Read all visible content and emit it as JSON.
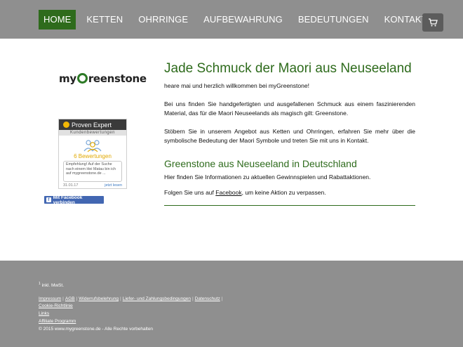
{
  "nav": {
    "items": [
      "HOME",
      "KETTEN",
      "OHRRINGE",
      "AUFBEWAHRUNG",
      "BEDEUTUNGEN",
      "KONTAKT"
    ],
    "active_index": 0,
    "active_color": "#2e6b1c",
    "cart_icon": "shopping-cart-icon"
  },
  "logo": {
    "prefix": "my",
    "suffix": "reenstone",
    "brand_color": "#2d7a26"
  },
  "proven_expert": {
    "title": "Proven Expert",
    "subtitle": "Kundenbewertungen",
    "count_label": "6 Bewertungen",
    "quote": "Empfehlung! Auf der Suche nach einem Hei Matau bin ich auf mygreenstone.de ...",
    "date": "31.01.17",
    "read_more": "jetzt lesen"
  },
  "facebook": {
    "label": "Mit Facebook verbinden"
  },
  "main": {
    "title": "Jade Schmuck der Maori aus Neuseeland",
    "greeting": "heare mai und herzlich willkommen bei myGreenstone!",
    "paragraph1": "Bei uns finden Sie handgefertigten und ausgefallenen Schmuck aus einem faszinierenden Material, das für die Maori Neuseelands als magisch gilt: Greenstone.",
    "paragraph2": "Stöbern Sie in unserem Angebot aus Ketten und Ohrringen, erfahren Sie mehr über die symbolische Bedeutung der Maori Symbole und treten Sie mit uns in Kontakt.",
    "subtitle": "Greenstone aus Neuseeland in Deutschland",
    "info": "Hier finden Sie Informationen zu aktuellen Gewinnspielen und Rabattaktionen.",
    "follow_prefix": "Folgen Sie uns auf ",
    "follow_link": "Facebook",
    "follow_suffix": ", um keine Aktion zu verpassen."
  },
  "footer": {
    "footnote_mark": "1",
    "footnote_text": " inkl. MwSt.",
    "links": [
      "Impressum",
      "AGB",
      "Widerrufsbelehrung",
      "Liefer- und Zahlungsbedingungen",
      "Datenschutz"
    ],
    "cookie": "Cookie-Richtlinie",
    "links_item": "Links",
    "affiliate": "Affiliate Programm",
    "copyright": "© 2015 www.mygreenstone.de - Alle Rechte vorbehalten"
  }
}
